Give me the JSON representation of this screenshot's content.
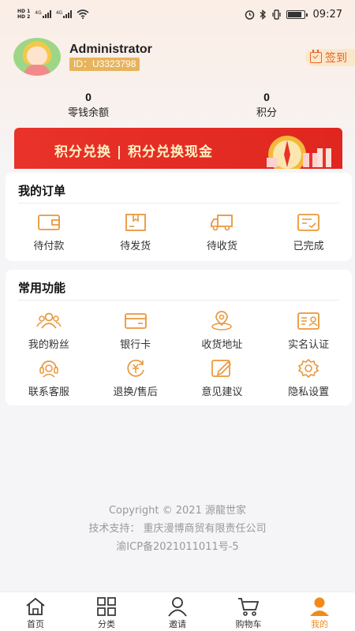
{
  "status_bar": {
    "hd1": "HD 1",
    "hd2": "HD 2",
    "net1": "4G",
    "net2": "4G",
    "time": "09:27"
  },
  "profile": {
    "username": "Administrator",
    "user_id": "ID：U3323798",
    "checkin_label": "签到",
    "balance_value": "0",
    "balance_label": "零钱余额",
    "points_value": "0",
    "points_label": "积分"
  },
  "banner": {
    "text": "积分兑换 | 积分兑换现金"
  },
  "orders": {
    "title": "我的订单",
    "items": [
      {
        "label": "待付款",
        "icon": "wallet-icon"
      },
      {
        "label": "待发货",
        "icon": "package-icon"
      },
      {
        "label": "待收货",
        "icon": "truck-icon"
      },
      {
        "label": "已完成",
        "icon": "completed-icon"
      }
    ]
  },
  "functions": {
    "title": "常用功能",
    "items": [
      {
        "label": "我的粉丝",
        "icon": "fans-icon"
      },
      {
        "label": "银行卡",
        "icon": "bank-card-icon"
      },
      {
        "label": "收货地址",
        "icon": "location-icon"
      },
      {
        "label": "实名认证",
        "icon": "id-card-icon"
      },
      {
        "label": "联系客服",
        "icon": "customer-service-icon"
      },
      {
        "label": "退换/售后",
        "icon": "refund-icon"
      },
      {
        "label": "意见建议",
        "icon": "feedback-icon"
      },
      {
        "label": "隐私设置",
        "icon": "settings-icon"
      }
    ]
  },
  "footer": {
    "copyright": "Copyright © 2021 源龍世家",
    "support": "技术支持：  重庆漫博商贸有限责任公司",
    "icp": "渝ICP备2021011011号-5"
  },
  "tabbar": {
    "tabs": [
      {
        "label": "首页",
        "icon": "home-icon"
      },
      {
        "label": "分类",
        "icon": "category-icon"
      },
      {
        "label": "邀请",
        "icon": "invite-icon"
      },
      {
        "label": "购物车",
        "icon": "cart-icon"
      },
      {
        "label": "我的",
        "icon": "profile-icon",
        "active": true
      }
    ]
  },
  "colors": {
    "accent": "#f08a1b",
    "banner": "#e8322a",
    "badge": "#e7b35c"
  }
}
